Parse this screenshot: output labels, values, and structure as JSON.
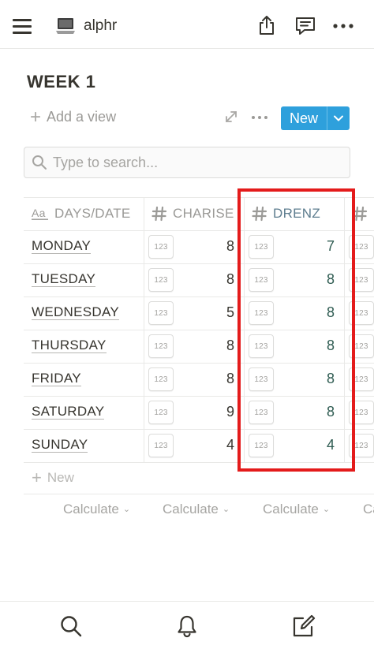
{
  "topbar": {
    "workspace_name": "alphr",
    "icons": [
      "hamburger-icon",
      "laptop-icon",
      "share-icon",
      "comment-icon",
      "more-icon"
    ]
  },
  "page": {
    "title": "WEEK 1"
  },
  "toolbar": {
    "add_view_label": "Add a view",
    "new_label": "New"
  },
  "search": {
    "placeholder": "Type to search..."
  },
  "table": {
    "columns": [
      {
        "label": "DAYS/DATE",
        "icon": "text-property-icon"
      },
      {
        "label": "CHARISE",
        "icon": "number-property-icon"
      },
      {
        "label": "DRENZ",
        "icon": "number-property-icon"
      },
      {
        "label": "",
        "icon": "number-property-icon"
      }
    ],
    "badge_text": "123",
    "rows": [
      {
        "day": "MONDAY",
        "charise": "8",
        "drenz": "7"
      },
      {
        "day": "TUESDAY",
        "charise": "8",
        "drenz": "8"
      },
      {
        "day": "WEDNESDAY",
        "charise": "5",
        "drenz": "8"
      },
      {
        "day": "THURSDAY",
        "charise": "8",
        "drenz": "8"
      },
      {
        "day": "FRIDAY",
        "charise": "8",
        "drenz": "8"
      },
      {
        "day": "SATURDAY",
        "charise": "9",
        "drenz": "8"
      },
      {
        "day": "SUNDAY",
        "charise": "4",
        "drenz": "4"
      }
    ],
    "new_row_label": "New",
    "calculate_label": "Calculate",
    "calculate_partial": "Ca"
  },
  "colors": {
    "accent_blue": "#2ea0dc",
    "highlight_red": "#e41b1b",
    "text": "#37352f",
    "muted": "#9b9a97"
  },
  "bottombar": {
    "icons": [
      "search-icon",
      "bell-icon",
      "compose-icon"
    ]
  }
}
